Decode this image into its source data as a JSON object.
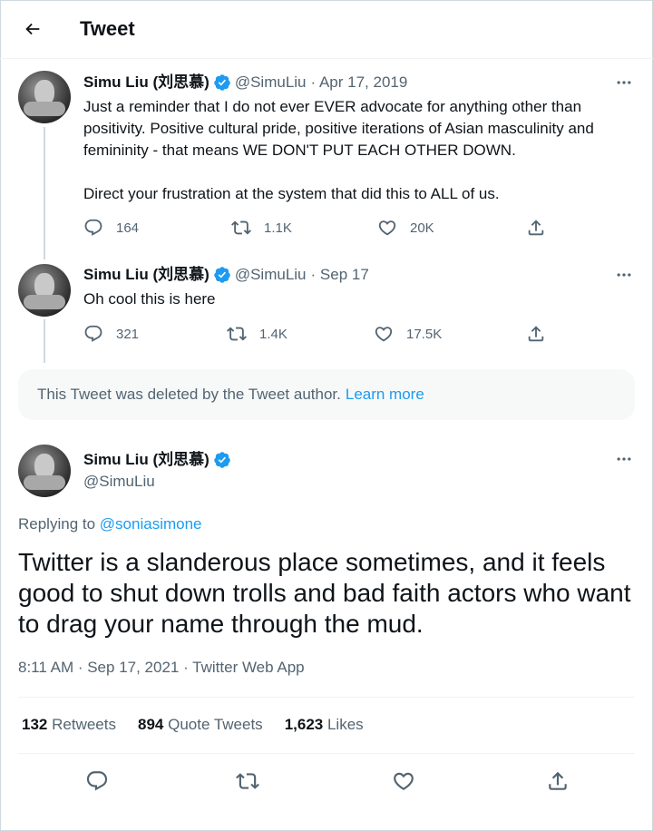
{
  "header": {
    "title": "Tweet"
  },
  "colors": {
    "accent": "#1d9bf0",
    "muted": "#536471",
    "text": "#0f1419"
  },
  "tweet1": {
    "name": "Simu Liu (刘思慕)",
    "handle": "@SimuLiu",
    "date": "· Apr 17, 2019",
    "text_p1": "Just a reminder that I do not ever EVER advocate for anything other than positivity. Positive cultural pride, positive iterations of Asian masculinity and femininity - that means WE DON'T PUT EACH OTHER DOWN.",
    "text_p2": "Direct your frustration at the system that did this to ALL of us.",
    "replies": "164",
    "retweets": "1.1K",
    "likes": "20K"
  },
  "tweet2": {
    "name": "Simu Liu (刘思慕)",
    "handle": "@SimuLiu",
    "date": "· Sep 17",
    "text": "Oh cool this is here",
    "replies": "321",
    "retweets": "1.4K",
    "likes": "17.5K"
  },
  "deleted": {
    "text": "This Tweet was deleted by the Tweet author.",
    "link": "Learn more"
  },
  "main": {
    "name": "Simu Liu (刘思慕)",
    "handle": "@SimuLiu",
    "replying_to_label": "Replying to",
    "replying_to_handle": "@soniasimone",
    "text": "Twitter is a slanderous place sometimes, and it feels good to shut down trolls and bad faith actors who want to drag your name through the mud.",
    "timestamp": "8:11 AM · Sep 17, 2021 · Twitter Web App",
    "retweets_count": "132",
    "retweets_label": "Retweets",
    "quotes_count": "894",
    "quotes_label": "Quote Tweets",
    "likes_count": "1,623",
    "likes_label": "Likes"
  },
  "icons": {
    "back": "arrow-left-icon",
    "verified": "verified-badge-icon",
    "more": "more-horizontal-icon",
    "reply": "reply-bubble-icon",
    "retweet": "retweet-icon",
    "like": "heart-icon",
    "share": "share-upload-icon"
  }
}
